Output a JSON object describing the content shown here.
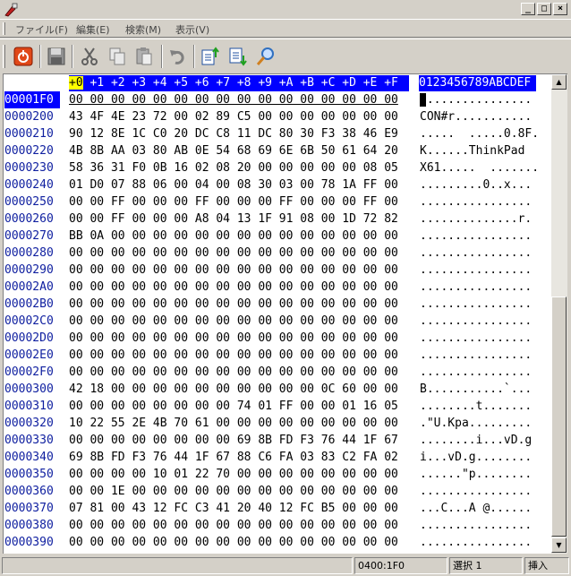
{
  "menu": [
    "ファイル(F)",
    "編集(E)",
    "検索(M)",
    "表示(V)"
  ],
  "window_buttons": [
    "_",
    "□",
    "×"
  ],
  "toolbar_icons": [
    "power-icon",
    "save-icon",
    "cut-icon",
    "copy-icon",
    "paste-icon",
    "undo-icon",
    "import-icon",
    "export-icon",
    "find-icon"
  ],
  "header": {
    "offsets": "+0 +1 +2 +3 +4 +5 +6 +7 +8 +9 +A +B +C +D +E +F",
    "ascii": "0123456789ABCDEF"
  },
  "rows": [
    {
      "addr": "00001F0",
      "hex": "00 00 00 00 00 00 00 00 00 00 00 00 00 00 00 00",
      "ascii": "................"
    },
    {
      "addr": "0000200",
      "hex": "43 4F 4E 23 72 00 02 89 C5 00 00 00 00 00 00 00",
      "ascii": "CON#r..........."
    },
    {
      "addr": "0000210",
      "hex": "90 12 8E 1C C0 20 DC C8 11 DC 80 30 F3 38 46 E9",
      "ascii": ".....  .....0.8F."
    },
    {
      "addr": "0000220",
      "hex": "4B 8B AA 03 80 AB 0E 54 68 69 6E 6B 50 61 64 20",
      "ascii": "K......ThinkPad "
    },
    {
      "addr": "0000230",
      "hex": "58 36 31 F0 0B 16 02 08 20 00 00 00 00 00 08 05",
      "ascii": "X61.....  ......."
    },
    {
      "addr": "0000240",
      "hex": "01 D0 07 88 06 00 04 00 08 30 03 00 78 1A FF 00",
      "ascii": ".........0..x..."
    },
    {
      "addr": "0000250",
      "hex": "00 00 FF 00 00 00 FF 00 00 00 FF 00 00 00 FF 00",
      "ascii": "................"
    },
    {
      "addr": "0000260",
      "hex": "00 00 FF 00 00 00 A8 04 13 1F 91 08 00 1D 72 82",
      "ascii": "..............r."
    },
    {
      "addr": "0000270",
      "hex": "BB 0A 00 00 00 00 00 00 00 00 00 00 00 00 00 00",
      "ascii": "................"
    },
    {
      "addr": "0000280",
      "hex": "00 00 00 00 00 00 00 00 00 00 00 00 00 00 00 00",
      "ascii": "................"
    },
    {
      "addr": "0000290",
      "hex": "00 00 00 00 00 00 00 00 00 00 00 00 00 00 00 00",
      "ascii": "................"
    },
    {
      "addr": "00002A0",
      "hex": "00 00 00 00 00 00 00 00 00 00 00 00 00 00 00 00",
      "ascii": "................"
    },
    {
      "addr": "00002B0",
      "hex": "00 00 00 00 00 00 00 00 00 00 00 00 00 00 00 00",
      "ascii": "................"
    },
    {
      "addr": "00002C0",
      "hex": "00 00 00 00 00 00 00 00 00 00 00 00 00 00 00 00",
      "ascii": "................"
    },
    {
      "addr": "00002D0",
      "hex": "00 00 00 00 00 00 00 00 00 00 00 00 00 00 00 00",
      "ascii": "................"
    },
    {
      "addr": "00002E0",
      "hex": "00 00 00 00 00 00 00 00 00 00 00 00 00 00 00 00",
      "ascii": "................"
    },
    {
      "addr": "00002F0",
      "hex": "00 00 00 00 00 00 00 00 00 00 00 00 00 00 00 00",
      "ascii": "................"
    },
    {
      "addr": "0000300",
      "hex": "42 18 00 00 00 00 00 00 00 00 00 00 0C 60 00 00",
      "ascii": "B...........`..."
    },
    {
      "addr": "0000310",
      "hex": "00 00 00 00 00 00 00 00 74 01 FF 00 00 01 16 05",
      "ascii": "........t......."
    },
    {
      "addr": "0000320",
      "hex": "10 22 55 2E 4B 70 61 00 00 00 00 00 00 00 00 00",
      "ascii": ".\"U.Kpa........."
    },
    {
      "addr": "0000330",
      "hex": "00 00 00 00 00 00 00 00 69 8B FD F3 76 44 1F 67",
      "ascii": "........i...vD.g"
    },
    {
      "addr": "0000340",
      "hex": "69 8B FD F3 76 44 1F 67 88 C6 FA 03 83 C2 FA 02",
      "ascii": "i...vD.g........"
    },
    {
      "addr": "0000350",
      "hex": "00 00 00 00 10 01 22 70 00 00 00 00 00 00 00 00",
      "ascii": "......\"p........"
    },
    {
      "addr": "0000360",
      "hex": "00 00 1E 00 00 00 00 00 00 00 00 00 00 00 00 00",
      "ascii": "................"
    },
    {
      "addr": "0000370",
      "hex": "07 81 00 43 12 FC C3 41 20 40 12 FC B5 00 00 00",
      "ascii": "...C...A @......"
    },
    {
      "addr": "0000380",
      "hex": "00 00 00 00 00 00 00 00 00 00 00 00 00 00 00 00",
      "ascii": "................"
    },
    {
      "addr": "0000390",
      "hex": "00 00 00 00 00 00 00 00 00 00 00 00 00 00 00 00",
      "ascii": "................"
    }
  ],
  "status": {
    "position": "0400:1F0",
    "selection": "選択 1",
    "mode": "挿入"
  }
}
